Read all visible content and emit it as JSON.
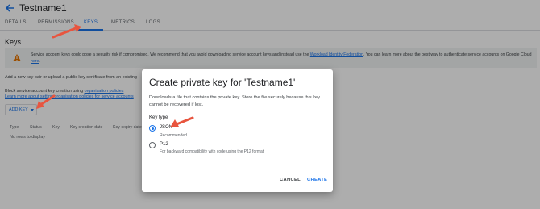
{
  "header": {
    "title": "Testname1"
  },
  "tabs": [
    {
      "label": "DETAILS"
    },
    {
      "label": "PERMISSIONS"
    },
    {
      "label": "KEYS"
    },
    {
      "label": "METRICS"
    },
    {
      "label": "LOGS"
    }
  ],
  "keys": {
    "section_title": "Keys",
    "warning": {
      "text_part1": "Service account keys could pose a security risk if compromised. We recommend that you avoid downloading service account keys and instead use the ",
      "link1": "Workload Identity Federation",
      "text_part2": ". You can learn more about the best way to authenticate service accounts on Google Cloud ",
      "link2": "here",
      "text_part3": "."
    },
    "add_pair_text": "Add a new key pair or upload a public key certificate from an existing",
    "block_text": "Block service account key creation using ",
    "block_link": "organisation policies",
    "learn_more_link": "Learn more about setting organisation policies for service accounts",
    "add_key_label": "ADD KEY",
    "table": {
      "columns": [
        "Type",
        "Status",
        "Key",
        "Key creation date",
        "Key expiry date"
      ],
      "empty": "No rows to display"
    }
  },
  "dialog": {
    "title": "Create private key for 'Testname1'",
    "description": "Downloads a file that contains the private key. Store the file securely because this key cannot be recovered if lost.",
    "key_type_label": "Key type",
    "options": [
      {
        "label": "JSON",
        "hint": "Recommended",
        "selected": true
      },
      {
        "label": "P12",
        "hint": "For backward compatibility with code using the P12 format",
        "selected": false
      }
    ],
    "cancel_label": "CANCEL",
    "create_label": "CREATE"
  },
  "colors": {
    "accent": "#1a73e8",
    "annotation_arrow": "#e8553f"
  }
}
